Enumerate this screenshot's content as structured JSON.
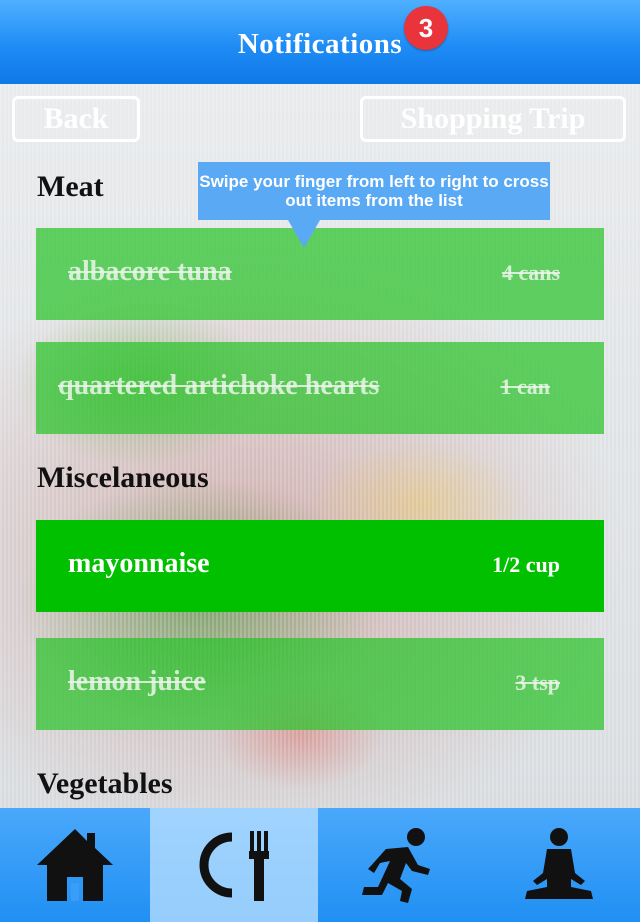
{
  "header": {
    "title": "Notifications",
    "badge_count": "3"
  },
  "toolbar": {
    "back_label": "Back",
    "trip_label": "Shopping Trip"
  },
  "tooltip": {
    "text": "Swipe your finger from left to right to cross out items from the list"
  },
  "sections": {
    "meat": {
      "title": "Meat",
      "items": [
        {
          "name": "albacore tuna",
          "qty": "4 cans",
          "crossed": true
        },
        {
          "name": "quartered artichoke hearts",
          "qty": "1 can",
          "crossed": true
        }
      ]
    },
    "misc": {
      "title": "Miscelaneous",
      "items": [
        {
          "name": "mayonnaise",
          "qty": "1/2 cup",
          "crossed": false
        },
        {
          "name": "lemon juice",
          "qty": "3 tsp",
          "crossed": true
        }
      ]
    },
    "veg": {
      "title": "Vegetables"
    }
  },
  "tabs": [
    {
      "icon": "home-icon",
      "selected": false
    },
    {
      "icon": "dining-icon",
      "selected": true
    },
    {
      "icon": "running-icon",
      "selected": false
    },
    {
      "icon": "meditation-icon",
      "selected": false
    }
  ],
  "colors": {
    "header_blue": "#1f8cf5",
    "item_green": "#00c000",
    "badge_red": "#e8343a"
  }
}
